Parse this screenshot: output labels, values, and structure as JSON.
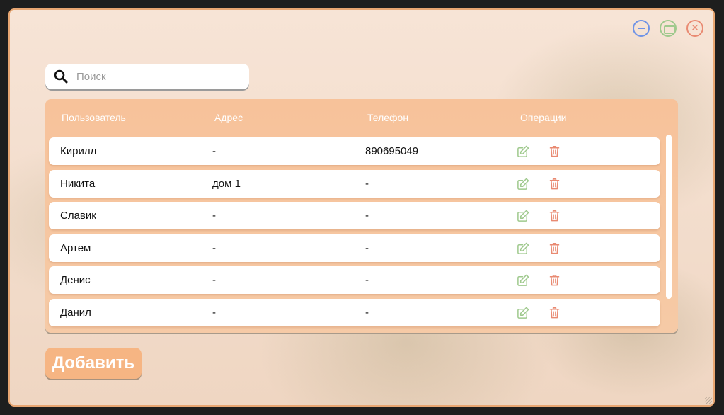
{
  "window": {
    "controls": [
      "minimize",
      "maximize",
      "close"
    ],
    "close_glyph": "✕"
  },
  "search": {
    "placeholder": "Поиск",
    "value": ""
  },
  "table": {
    "columns": [
      "Пользователь",
      "Адрес",
      "Телефон",
      "Операции"
    ],
    "rows": [
      {
        "user": "Кирилл",
        "address": "-",
        "phone": "890695049"
      },
      {
        "user": "Никита",
        "address": "дом 1",
        "phone": "-"
      },
      {
        "user": "Славик",
        "address": "-",
        "phone": "-"
      },
      {
        "user": "Артем",
        "address": "-",
        "phone": "-"
      },
      {
        "user": "Денис",
        "address": "-",
        "phone": "-"
      },
      {
        "user": "Данил",
        "address": "-",
        "phone": "-"
      }
    ],
    "operation_icons": [
      "edit-icon",
      "trash-icon"
    ]
  },
  "add_button": {
    "label": "Добавить"
  },
  "colors": {
    "accent": "#f6b583",
    "header": "#f7c29a",
    "edit": "#9fc98d",
    "delete": "#e98a72",
    "minimize": "#6f93e6"
  }
}
